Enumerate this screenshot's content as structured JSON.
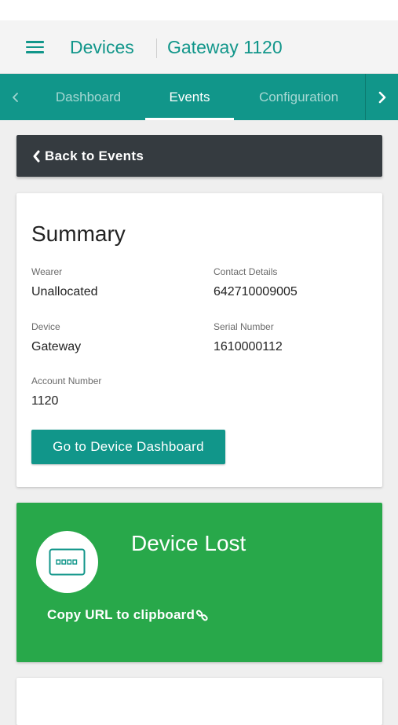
{
  "header": {
    "title": "Devices",
    "subtitle": "Gateway 1120"
  },
  "tabs": [
    {
      "label": "Dashboard",
      "active": false
    },
    {
      "label": "Events",
      "active": true
    },
    {
      "label": "Configuration",
      "active": false
    }
  ],
  "back": {
    "label": "Back to Events"
  },
  "summary": {
    "title": "Summary",
    "fields": {
      "wearer": {
        "label": "Wearer",
        "value": "Unallocated"
      },
      "contact": {
        "label": "Contact Details",
        "value": "642710009005"
      },
      "device": {
        "label": "Device",
        "value": "Gateway"
      },
      "serial": {
        "label": "Serial Number",
        "value": "1610000112"
      },
      "account": {
        "label": "Account Number",
        "value": "1120"
      }
    },
    "button_label": "Go to Device Dashboard"
  },
  "event": {
    "title": "Device Lost",
    "copy_label": "Copy URL to clipboard",
    "icon": "gateway-device-icon",
    "color": "#28a84a"
  },
  "colors": {
    "accent": "#11968a",
    "dark_bar": "#353b40",
    "event_green": "#28a84a"
  }
}
